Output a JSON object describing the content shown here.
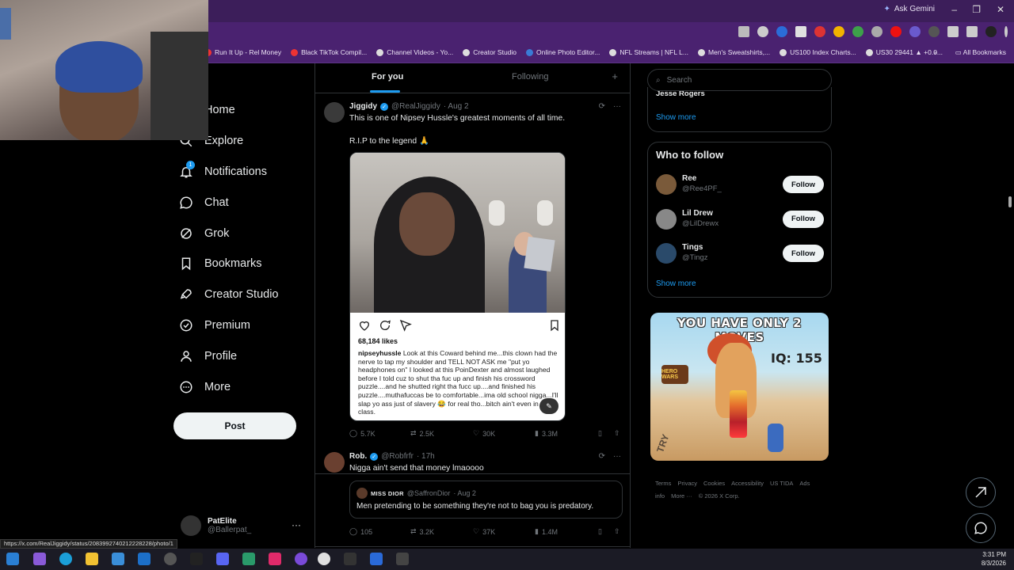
{
  "browser": {
    "ask_gemini": "Ask Gemini",
    "bookmarks": [
      {
        "label": "Run It Up - Rel Money",
        "color": "#e33"
      },
      {
        "label": "Black TikTok Compil...",
        "color": "#e33"
      },
      {
        "label": "Channel Videos - Yo...",
        "color": "#ddd"
      },
      {
        "label": "Creator Studio",
        "color": "#ddd"
      },
      {
        "label": "Online Photo Editor...",
        "color": "#3a7bd5"
      },
      {
        "label": "NFL Streams | NFL L...",
        "color": "#ddd"
      },
      {
        "label": "Men's Sweatshirts,...",
        "color": "#ddd"
      },
      {
        "label": "US100 Index Charts...",
        "color": "#ddd"
      },
      {
        "label": "US30 29441 ▲ +0.0...",
        "color": "#ddd"
      }
    ],
    "bookmarks_overflow": "»",
    "all_bookmarks": "All Bookmarks",
    "status_url": "https://x.com/RealJiggidy/status/2083992740212228228/photo/1"
  },
  "nav": {
    "items": [
      {
        "label": "Home",
        "icon": "home-icon"
      },
      {
        "label": "Explore",
        "icon": "search-icon"
      },
      {
        "label": "Notifications",
        "icon": "bell-icon",
        "badge": "1"
      },
      {
        "label": "Chat",
        "icon": "chat-icon"
      },
      {
        "label": "Grok",
        "icon": "grok-icon"
      },
      {
        "label": "Bookmarks",
        "icon": "bookmark-icon"
      },
      {
        "label": "Creator Studio",
        "icon": "rocket-icon"
      },
      {
        "label": "Premium",
        "icon": "verified-icon"
      },
      {
        "label": "Profile",
        "icon": "person-icon"
      },
      {
        "label": "More",
        "icon": "more-circle-icon"
      }
    ],
    "post_label": "Post",
    "account": {
      "name": "PatElite",
      "handle": "@Ballerpat_",
      "more": "···"
    }
  },
  "timeline": {
    "tabs": {
      "for_you": "For you",
      "following": "Following",
      "add": "+"
    },
    "tweet1": {
      "name": "Jiggidy",
      "handle": "@RealJiggidy",
      "date": "· Aug 2",
      "text1": "This is one of Nipsey Hussle's greatest moments of all time.",
      "text2": "R.I.P to the legend 🙏",
      "ig": {
        "likes": "68,184 likes",
        "user": "nipseyhussle",
        "caption": "Look at this Coward behind me...this clown had the nerve to tap my shoulder and TELL NOT ASK me \"put yo headphones on\" I looked at this PoinDexter and almost laughed before I told cuz to shut tha fuc up and finish his crossword puzzle....and he shutted right tha fucc up....and finished his puzzle....muthafuccas be to comfortable...ima old school nigga...I'll slap yo ass just of slavery 😂 for real tho...bitch ain't even in first class."
      },
      "stats": {
        "replies": "5.7K",
        "reposts": "2.5K",
        "likes": "30K",
        "views": "3.3M"
      }
    },
    "tweet2": {
      "name": "Rob.",
      "handle": "@Robfrfr",
      "date": "· 17h",
      "text": "Nigga ain't send that money lmaoooo",
      "quote": {
        "name": "MISS DIOR",
        "handle": "@SaffronDior",
        "date": "· Aug 2",
        "text": "Men pretending to be something they're not to bag you is predatory."
      },
      "stats": {
        "replies": "105",
        "reposts": "3.2K",
        "likes": "37K",
        "views": "1.4M"
      }
    }
  },
  "sidebar": {
    "search_placeholder": "Search",
    "trend_cut": "Jesse Rogers",
    "show_more": "Show more",
    "who_to_follow": "Who to follow",
    "follow_label": "Follow",
    "people": [
      {
        "name": "Ree",
        "handle": "@Ree4PF_",
        "color": "#7a5a3a"
      },
      {
        "name": "Lil Drew",
        "handle": "@LilDrewx",
        "color": "#888"
      },
      {
        "name": "Tings",
        "handle": "@Tingz",
        "color": "#2a4a6a"
      }
    ],
    "ad": {
      "title": "YOU HAVE ONLY 2 MOVES",
      "iq": "IQ: 155",
      "logo": "HERO WARS",
      "try": "TRY"
    },
    "footer": [
      "Terms",
      "Privacy",
      "Cookies",
      "Accessibility",
      "US TIDA",
      "Ads info",
      "More ···",
      "© 2026 X Corp."
    ]
  },
  "taskbar": {
    "time": "3:31 PM",
    "date": "8/3/2026"
  }
}
